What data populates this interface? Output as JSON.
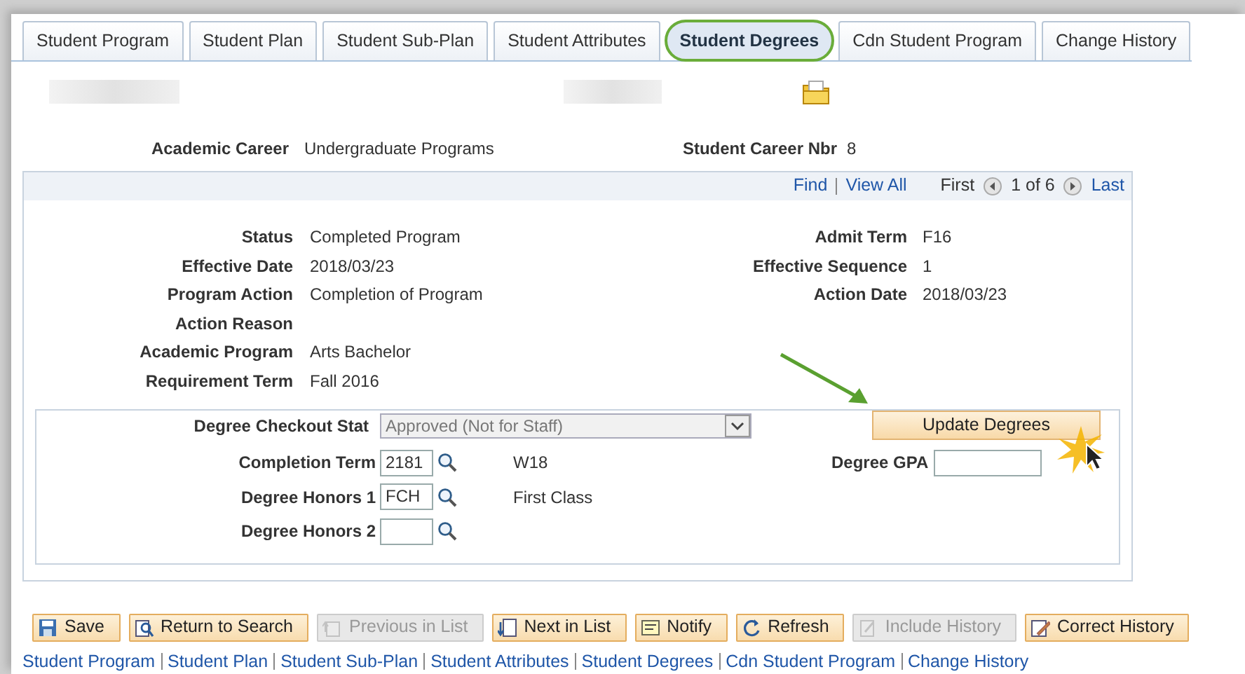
{
  "tabs": [
    {
      "label": "Student Program",
      "selected": false
    },
    {
      "label": "Student Plan",
      "selected": false
    },
    {
      "label": "Student Sub-Plan",
      "selected": false
    },
    {
      "label": "Student Attributes",
      "selected": false
    },
    {
      "label": "Student Degrees",
      "selected": true
    },
    {
      "label": "Cdn Student Program",
      "selected": false
    },
    {
      "label": "Change History",
      "selected": false
    }
  ],
  "header": {
    "career_label": "Academic Career",
    "career_value": "Undergraduate Programs",
    "nbr_label": "Student Career Nbr",
    "nbr_value": "8"
  },
  "navigator": {
    "find": "Find",
    "view_all": "View All",
    "first": "First",
    "position": "1 of 6",
    "last": "Last"
  },
  "left_fields": [
    {
      "label": "Status",
      "value": "Completed Program"
    },
    {
      "label": "Effective Date",
      "value": "2018/03/23"
    },
    {
      "label": "Program Action",
      "value": "Completion of Program"
    },
    {
      "label": "Action Reason"
    },
    {
      "label": "Academic Program",
      "value": "Arts Bachelor"
    },
    {
      "label": "Requirement Term",
      "value": "Fall 2016"
    }
  ],
  "right_fields": [
    {
      "label": "Admit Term",
      "value": "F16"
    },
    {
      "label": "Effective Sequence",
      "value": "1"
    },
    {
      "label": "Action Date",
      "value": "2018/03/23"
    }
  ],
  "degree": {
    "checkout_label": "Degree Checkout Stat",
    "checkout_value": "Approved (Not for Staff)",
    "update_button": "Update Degrees",
    "rows": [
      {
        "label": "Completion Term",
        "value": "2181",
        "description": "W18"
      },
      {
        "label": "Degree Honors 1",
        "value": "FCH",
        "description": "First Class"
      },
      {
        "label": "Degree Honors 2"
      }
    ],
    "gpa_label": "Degree GPA"
  },
  "toolbar": [
    {
      "label": "Save",
      "disabled": false
    },
    {
      "label": "Return to Search",
      "disabled": false
    },
    {
      "label": "Previous in List",
      "disabled": true
    },
    {
      "label": "Next in List",
      "disabled": false
    },
    {
      "label": "Notify",
      "disabled": false
    },
    {
      "label": "Refresh",
      "disabled": false
    },
    {
      "label": "Include History",
      "disabled": true
    },
    {
      "label": "Correct History",
      "disabled": false
    }
  ],
  "footer_links": [
    "Student Program",
    "Student Plan",
    "Student Sub-Plan",
    "Student Attributes",
    "Student Degrees",
    "Cdn Student Program",
    "Change History"
  ]
}
